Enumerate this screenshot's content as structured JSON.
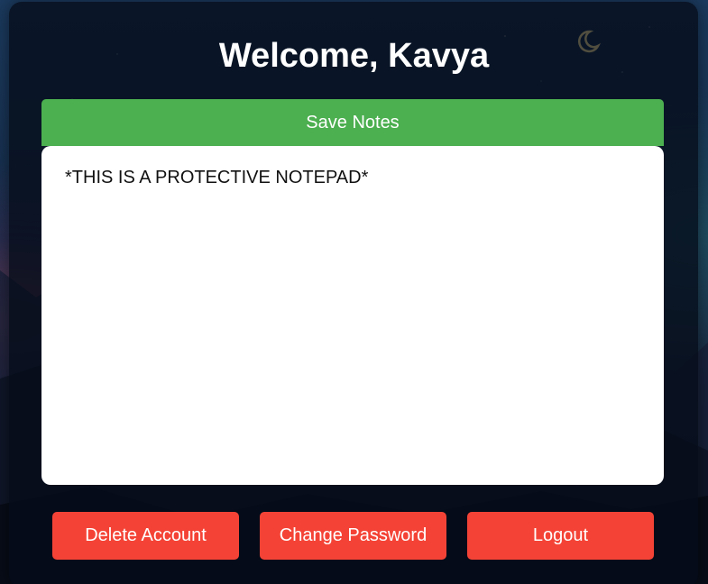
{
  "header": {
    "title": "Welcome, Kavya"
  },
  "toolbar": {
    "save_label": "Save Notes"
  },
  "notepad": {
    "value": "*THIS IS A PROTECTIVE NOTEPAD*"
  },
  "actions": {
    "delete_label": "Delete Account",
    "change_password_label": "Change Password",
    "logout_label": "Logout"
  },
  "colors": {
    "save_button": "#4caf50",
    "danger_button": "#f44336",
    "card_background": "#050c18"
  },
  "icons": {
    "moon": "moon-icon"
  }
}
